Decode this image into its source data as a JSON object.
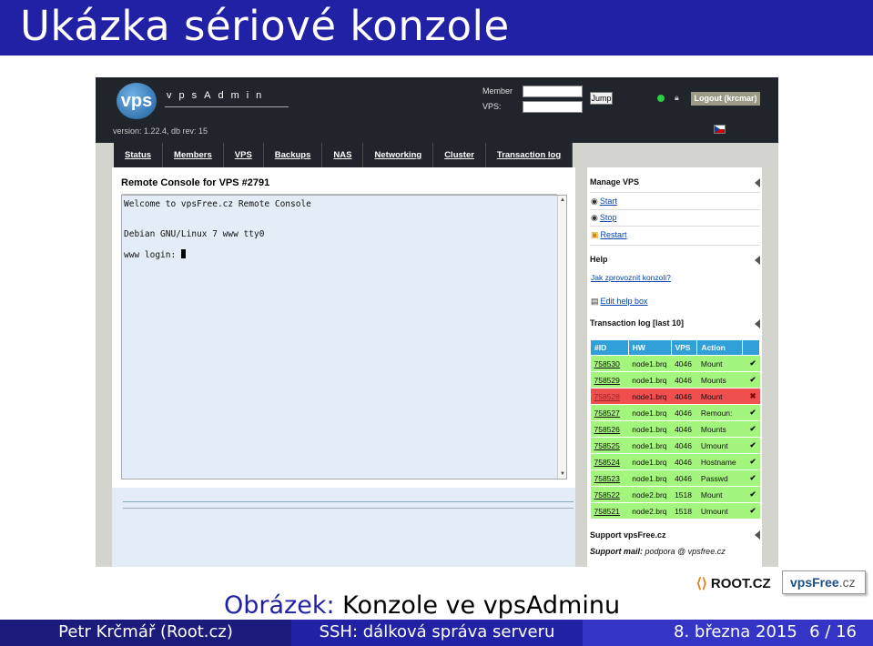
{
  "slide": {
    "title": "Ukázka sériové konzole",
    "caption_label": "Obrázek:",
    "caption_text": "Konzole ve vpsAdminu",
    "footer_author": "Petr Krčmář  (Root.cz)",
    "footer_topic": "SSH: dálková správa serveru",
    "footer_date": "8. března 2015",
    "footer_page": "6 / 16",
    "logo_root": "ROOT.CZ",
    "logo_vpsfree": "vpsFree",
    "logo_vpsfree_tld": ".cz"
  },
  "app": {
    "logo_mark": "vps",
    "logo_name": "vpsAdmin",
    "version": "version: 1.22.4, db rev: 15",
    "member_label": "Member",
    "vps_label": "VPS:",
    "jump_label": "Jump",
    "logout_label": "Logout (krcmar)",
    "status_color": "#2ecc40",
    "nav": [
      "Status",
      "Members",
      "VPS",
      "Backups",
      "NAS",
      "Networking",
      "Cluster",
      "Transaction log"
    ]
  },
  "console": {
    "title": "Remote Console for VPS #2791",
    "lines": [
      "Welcome to vpsFree.cz Remote Console",
      "Debian GNU/Linux 7 www tty0",
      "www login: "
    ]
  },
  "sidebar": {
    "manage_title": "Manage VPS",
    "start": "Start",
    "stop": "Stop",
    "restart": "Restart",
    "help_title": "Help",
    "help_link": "Jak zprovoznit konzoli?",
    "edit_help": "Edit help box",
    "tlog_title": "Transaction log [last 10]",
    "tlog_headers": [
      "#ID",
      "HW",
      "VPS",
      "Action"
    ],
    "tlog_rows": [
      {
        "id": "758530",
        "hw": "node1.brq",
        "vps": "4046",
        "action": "Mount",
        "ok": true
      },
      {
        "id": "758529",
        "hw": "node1.brq",
        "vps": "4046",
        "action": "Mounts",
        "ok": true
      },
      {
        "id": "758528",
        "hw": "node1.brq",
        "vps": "4046",
        "action": "Mount",
        "ok": false
      },
      {
        "id": "758527",
        "hw": "node1.brq",
        "vps": "4046",
        "action": "Remoun:",
        "ok": true
      },
      {
        "id": "758526",
        "hw": "node1.brq",
        "vps": "4046",
        "action": "Mounts",
        "ok": true
      },
      {
        "id": "758525",
        "hw": "node1.brq",
        "vps": "4046",
        "action": "Umount",
        "ok": true
      },
      {
        "id": "758524",
        "hw": "node1.brq",
        "vps": "4046",
        "action": "Hostname",
        "ok": true
      },
      {
        "id": "758523",
        "hw": "node1.brq",
        "vps": "4046",
        "action": "Passwd",
        "ok": true
      },
      {
        "id": "758522",
        "hw": "node2.brq",
        "vps": "1518",
        "action": "Mount",
        "ok": true
      },
      {
        "id": "758521",
        "hw": "node2.brq",
        "vps": "1518",
        "action": "Umount",
        "ok": true
      }
    ],
    "support_title": "Support vpsFree.cz",
    "support_mail_label": "Support mail:",
    "support_mail": "podpora @ vpsfree.cz"
  }
}
